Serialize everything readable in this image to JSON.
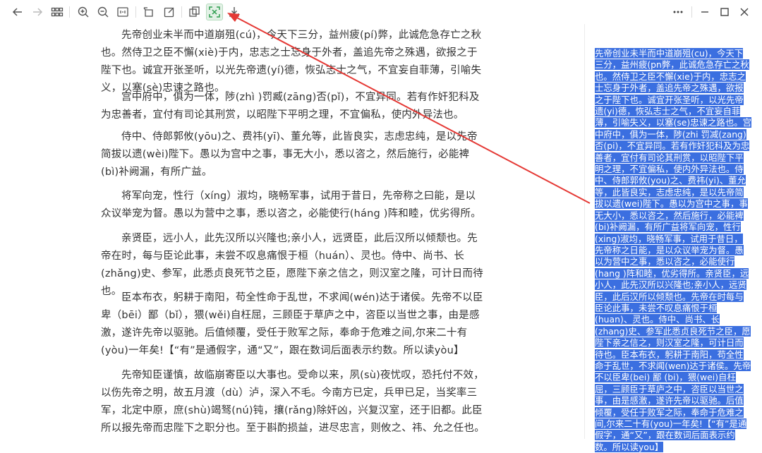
{
  "toolbar": {
    "icons": [
      "back-icon",
      "forward-icon",
      "grid-icon",
      "zoom-in-icon",
      "zoom-out-icon",
      "fit-width-icon",
      "rotate-icon",
      "edit-icon",
      "copy-icon",
      "ocr-icon",
      "download-icon",
      "more-icon",
      "minimize-icon",
      "maximize-icon",
      "close-icon"
    ],
    "accent_color": "#2e9e4f"
  },
  "document": {
    "paragraphs": [
      "先帝创业未半而中道崩殂(cú)，今天下三分，益州疲(pí)弊，此诚危急存亡之秋也。然侍卫之臣不懈(xiè)于内，忠志之士忘身于外者，盖追先帝之殊遇，欲报之于陛下也。诚宜开张圣听，以光先帝遗(yí)德，恢弘志士之气，不宜妄自菲薄，引喻失义，以塞(sè)忠谏之路也。",
      "宫中府中，俱为一体，陟(zhì )罚臧(zāng)否(pǐ)，不宜异同。若有作奸犯科及为忠善者，宜付有司论其刑赏，以昭陛下平明之理，不宜偏私，使内外异法也。",
      "侍中、侍郎郭攸(yōu)之、费祎(yī)、董允等，此皆良实，志虑忠纯，是以先帝简拔以遗(wèi)陛下。愚以为宫中之事，事无大小，悉以咨之，然后施行，必能裨(bì)补阙漏，有所广益。",
      "将军向宠，性行（xíng）淑均，晓畅军事，试用于昔日，先帝称之曰能，是以众议举宠为督。愚以为营中之事，悉以咨之，必能使行(háng )阵和睦，优劣得所。",
      "亲贤臣，远小人，此先汉所以兴隆也;亲小人，远贤臣，此后汉所以倾颓也。先帝在时，每与臣论此事，未尝不叹息痛恨于桓（huán）、灵也。侍中、尚书、长(zhǎng)史、参军，此悉贞良死节之臣，愿陛下亲之信之，则汉室之隆，可计日而待也。",
      "臣本布衣，躬耕于南阳，苟全性命于乱世，不求闻(wén)达于诸侯。先帝不以臣卑（bēi）鄙（bǐ），猥(wěi)自枉屈，三顾臣于草庐之中，咨臣以当世之事，由是感激，遂许先帝以驱驰。后值倾覆，受任于败军之际，奉命于危难之间,尔来二十有(yòu)一年矣!【“有”是通假字，通“又”，跟在数词后面表示约数。所以读yòu】",
      "先帝知臣谨慎，故临崩寄臣以大事也。受命以来，夙(sù)夜忧叹，恐托付不效，以伤先帝之明，故五月渡（dù）泸，深入不毛。今南方已定，兵甲已足，当奖率三军，北定中原，庶(shù)竭驽(nú)钝，攘(rǎng)除奸凶，兴复汉室，还于旧都。此臣所以报先帝而忠陛下之职分也。至于斟酌损益，进尽忠言，则攸之、祎、允之任也。"
    ]
  },
  "ocr_result": {
    "text": "先帝创业未半而中道崩殂(cu)，今天下三分，益州疲(pn弊，此诚危急存亡之秋也。然侍卫之臣不懈(xie)于内，忠志之士忘身于外者，盖追先帝之殊遇，欲报之于陛下也。诚宜开张圣听，以光先帝遗(yi)德，恢弘志士之气，不宜妄自菲薄，引喻失义，以塞(se)忠谏之路也。宫中府中，俱为一体，陟(zhi 罚减(zang)否(pi)，不宜异同。若有作奸犯科及为忠善者，宜付有司论其刑赏，以昭陛下平明之理，不宜偏私，使内外异法也。侍中、侍郎郭攸(you)之、费祎(yi)、董允等，此皆良实，志虑忠纯，是以先帝简拔以遗(wei)陛下。愚以为宫中之事，事无大小，悉以咨之，然后施行，必能裨(bi)补阙漏，有所广益将军向宠，性行(xing)淑均，晓畅军事，试用于昔日，先帝称之日能，是以众议举宠为督。愚以为营中之事，悉以咨之，必能使行(hang )阵和睦，优劣得所。亲贤臣，远小人，此先汉所以兴隆也;亲小人，远贤臣，此后汉所以倾颓也。先帝在时每与臣论此事，未尝不叹息痛恨于桓(huan)、灵也。侍中、尚书、长(zhang)史、参军此悉贞良死节之臣，愿陛下亲之信之，则汉室之隆，可计日而待也。臣本布衣，躬耕于南阳，苟全性命于乱世，不求闻(wen)达于诸侯。先帝不以臣卑(bei) 鄙 (bi)，猥(wei)自枉屈，三顾臣于草庐之中，咨臣以当世之事，由是感激，遂许先帝以驱驰。后值倾覆，受任于败军之际，奉命于危难之间,尔来二十有(you)一年矣!【“有”是通假字，通“又”，跟在数词后面表示约数。所以读you】",
    "highlight_color": "#3b6fe0"
  },
  "annotation": {
    "color": "#e53935"
  }
}
